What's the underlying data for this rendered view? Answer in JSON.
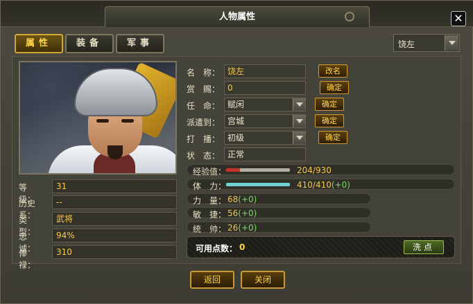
{
  "window": {
    "title": "人物属性",
    "close_label": "✕"
  },
  "tabs": [
    {
      "label": "属性",
      "active": true
    },
    {
      "label": "装备",
      "active": false
    },
    {
      "label": "军事",
      "active": false
    }
  ],
  "character_select": {
    "value": "饶左"
  },
  "left_stats": [
    {
      "label": "等　级：",
      "value": "31"
    },
    {
      "label": "历史系：",
      "value": "--"
    },
    {
      "label": "类　型：",
      "value": "武将"
    },
    {
      "label": "忠　诚：",
      "value": "94%"
    },
    {
      "label": "俸　禄：",
      "value": "310"
    }
  ],
  "fields": {
    "name": {
      "label": "名　称：",
      "value": "饶左",
      "button": "改名"
    },
    "reward": {
      "label": "赏　赐：",
      "value": "0",
      "button": "确定"
    },
    "appoint": {
      "label": "任　命：",
      "value": "赋闲",
      "button": "确定"
    },
    "dispatch": {
      "label": "派遣到：",
      "value": "宫城",
      "button": "确定"
    },
    "beat": {
      "label": "打　播：",
      "value": "初级",
      "button": "确定"
    },
    "status": {
      "label": "状　态：",
      "value": "正常"
    }
  },
  "bars": {
    "exp": {
      "label": "经验值：",
      "current": 204,
      "max": 930,
      "text": "204/930",
      "bonus": "",
      "color": "#c8302a"
    },
    "stamina": {
      "label": "体　力：",
      "current": 410,
      "max": 410,
      "text": "410/410",
      "bonus": "(+0)",
      "color": "#6fd2d2"
    }
  },
  "attributes": [
    {
      "label": "力　量：",
      "value": "68",
      "bonus": "(+0)"
    },
    {
      "label": "敏　捷：",
      "value": "56",
      "bonus": "(+0)"
    },
    {
      "label": "统　帅：",
      "value": "26",
      "bonus": "(+0)"
    }
  ],
  "points": {
    "label": "可用点数：",
    "value": "0",
    "wash_button": "洗点"
  },
  "bottom_buttons": {
    "back": "返回",
    "close": "关闭"
  },
  "colors": {
    "accent_gold": "#f5c64b",
    "bonus_green": "#7fd86a",
    "panel_bg": "#44433a"
  }
}
